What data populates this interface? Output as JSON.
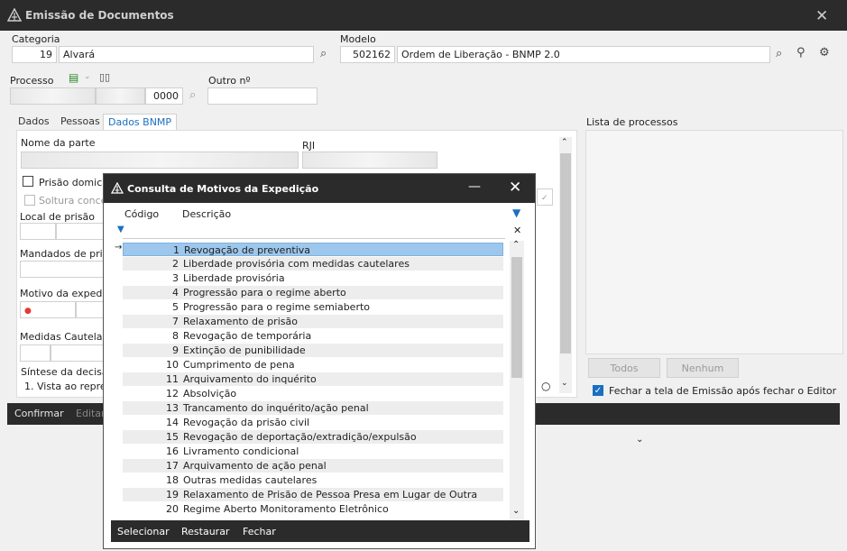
{
  "window": {
    "title": "Emissão de Documentos"
  },
  "categoria": {
    "label": "Categoria",
    "code": "19",
    "name": "Alvará"
  },
  "modelo": {
    "label": "Modelo",
    "code": "502162",
    "name": "Ordem de Liberação - BNMP 2.0"
  },
  "processo": {
    "label": "Processo",
    "suffix": "0000",
    "outro_label": "Outro nº"
  },
  "tabs": [
    "Dados",
    "Pessoas",
    "Dados BNMP"
  ],
  "form": {
    "nome_parte": "Nome da parte",
    "rji": "RJI",
    "prisao_domiciliar": "Prisão domicil",
    "soltura": "Soltura conced",
    "local_prisao": "Local de prisão",
    "mandados": "Mandados de pris",
    "motivo": "Motivo da expedi",
    "medidas": "Medidas Cautelare",
    "sintese": "Síntese da decisão",
    "sintese_text": "1. Vista ao repres"
  },
  "lista": {
    "label": "Lista de processos",
    "todos": "Todos",
    "nenhum": "Nenhum",
    "fechar_tela": "Fechar a tela de Emissão após fechar o Editor",
    "fechar_checked": true
  },
  "footer": {
    "confirmar": "Confirmar",
    "editar": "Editar"
  },
  "modal": {
    "title": "Consulta de Motivos da Expedição",
    "col_codigo": "Código",
    "col_descricao": "Descrição",
    "rows": [
      {
        "code": "1",
        "desc": "Revogação de preventiva"
      },
      {
        "code": "2",
        "desc": "Liberdade provisória com medidas cautelares"
      },
      {
        "code": "3",
        "desc": "Liberdade provisória"
      },
      {
        "code": "4",
        "desc": "Progressão para o regime aberto"
      },
      {
        "code": "5",
        "desc": "Progressão para o regime semiaberto"
      },
      {
        "code": "7",
        "desc": "Relaxamento de prisão"
      },
      {
        "code": "8",
        "desc": "Revogação de temporária"
      },
      {
        "code": "9",
        "desc": "Extinção de punibilidade"
      },
      {
        "code": "10",
        "desc": "Cumprimento de pena"
      },
      {
        "code": "11",
        "desc": "Arquivamento do inquérito"
      },
      {
        "code": "12",
        "desc": "Absolvição"
      },
      {
        "code": "13",
        "desc": "Trancamento do inquérito/ação penal"
      },
      {
        "code": "14",
        "desc": "Revogação da prisão civil"
      },
      {
        "code": "15",
        "desc": "Revogação de deportação/extradição/expulsão"
      },
      {
        "code": "16",
        "desc": "Livramento condicional"
      },
      {
        "code": "17",
        "desc": "Arquivamento de ação penal"
      },
      {
        "code": "18",
        "desc": "Outras medidas cautelares"
      },
      {
        "code": "19",
        "desc": "Relaxamento de Prisão de Pessoa Presa em Lugar de Outra"
      },
      {
        "code": "20",
        "desc": "Regime Aberto Monitoramento Eletrônico"
      }
    ],
    "footer": {
      "selecionar": "Selecionar",
      "restaurar": "Restaurar",
      "fechar": "Fechar"
    }
  }
}
